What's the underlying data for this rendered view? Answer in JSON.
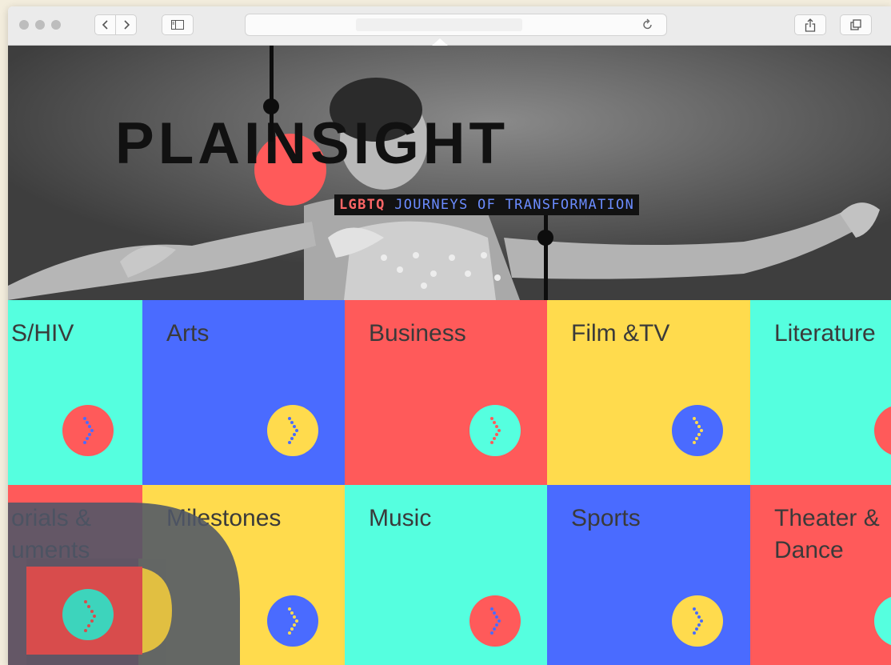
{
  "browser": {
    "back_icon": "chevron-left-icon",
    "forward_icon": "chevron-right-icon",
    "sidebar_icon": "sidebar-icon",
    "reload_icon": "reload-icon",
    "share_icon": "share-icon",
    "tabs_icon": "tabs-icon"
  },
  "hero": {
    "logo_part1": "PLA",
    "logo_part2": "IN",
    "logo_part3": "SIGHT",
    "tagline_highlight": "LGBTQ",
    "tagline_rest": " JOURNEYS OF TRANSFORMATION"
  },
  "colors": {
    "teal": "#55ffdf",
    "blue": "#4a6bff",
    "red": "#ff5a5a",
    "yellow": "#ffdb4d"
  },
  "categories": [
    {
      "label": "S/HIV",
      "bg": "#55ffdf",
      "btn": "#ff5a5a",
      "dots": "#55ffdf"
    },
    {
      "label": "Arts",
      "bg": "#4a6bff",
      "btn": "#ffdb4d",
      "dots": "#4a6bff"
    },
    {
      "label": "Business",
      "bg": "#ff5a5a",
      "btn": "#55ffdf",
      "dots": "#ff5a5a"
    },
    {
      "label": "Film &TV",
      "bg": "#ffdb4d",
      "btn": "#4a6bff",
      "dots": "#ffdb4d"
    },
    {
      "label": "Literature",
      "bg": "#55ffdf",
      "btn": "#ff5a5a",
      "dots": "#55ffdf"
    },
    {
      "label": "orials &\numents",
      "bg": "#ff5a5a",
      "btn": "#55ffdf",
      "dots": "#ff5a5a"
    },
    {
      "label": "Milestones",
      "bg": "#ffdb4d",
      "btn": "#4a6bff",
      "dots": "#ffdb4d"
    },
    {
      "label": "Music",
      "bg": "#55ffdf",
      "btn": "#ff5a5a",
      "dots": "#55ffdf"
    },
    {
      "label": "Sports",
      "bg": "#4a6bff",
      "btn": "#ffdb4d",
      "dots": "#4a6bff"
    },
    {
      "label": "Theater &\nDance",
      "bg": "#ff5a5a",
      "btn": "#55ffdf",
      "dots": "#ff5a5a"
    }
  ]
}
